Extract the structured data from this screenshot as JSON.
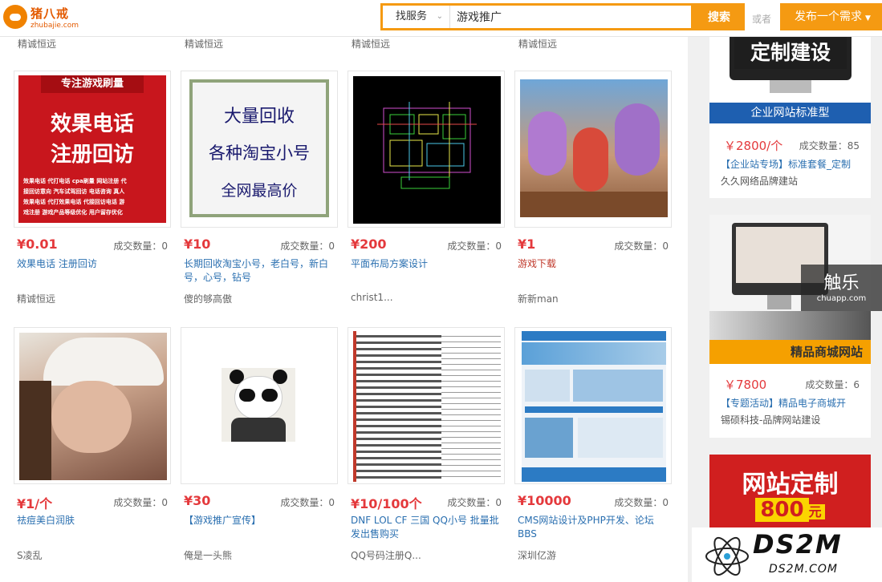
{
  "header": {
    "logo_cn": "猪八戒",
    "logo_en": "zhubajie.com",
    "search_type": "找服务",
    "search_value": "游戏推广",
    "search_button": "搜索",
    "or_text": "或者",
    "publish_button": "发布一个需求"
  },
  "prev_row_sellers": [
    "精诚恒远",
    "精诚恒远",
    "精诚恒远",
    "精诚恒远"
  ],
  "cards": [
    {
      "price": "¥0.01",
      "deals": "成交数量：0",
      "title": "效果电话 注册回访",
      "seller": "精诚恒远",
      "img_header": "专注游戏刷量",
      "img_line1": "效果电话",
      "img_line2": "注册回访",
      "img_small": [
        "效果电话 代打电话 cpa刷量 网站注册 代",
        "接回访意向 汽车试驾回访 电话咨询 真人",
        "效果电话 代打效果电话 代接回访电话 游",
        "戏注册 游戏产品等级优化 用户留存优化"
      ]
    },
    {
      "price": "¥10",
      "deals": "成交数量：0",
      "title": "长期回收淘宝小号，老白号，新白号，心号，钻号",
      "seller": "傻的够高傲",
      "img_lines": [
        "大量回收",
        "各种淘宝小号",
        "全网最高价"
      ]
    },
    {
      "price": "¥200",
      "deals": "成交数量：0",
      "title": "平面布局方案设计",
      "seller": "christ1..."
    },
    {
      "price": "¥1",
      "deals": "成交数量：0",
      "title": "游戏下载",
      "seller": "新新man"
    },
    {
      "price": "¥1/个",
      "deals": "成交数量：0",
      "title": "祛痘美白润肤",
      "seller": "S凌乱"
    },
    {
      "price": "¥30",
      "deals": "成交数量：0",
      "title": "【游戏推广宣传】",
      "seller": "俺是一头熊"
    },
    {
      "price": "¥10/100个",
      "deals": "成交数量：0",
      "title": "DNF LOL CF 三国 QQ小号 批量批发出售购买",
      "seller": "QQ号码注册Q..."
    },
    {
      "price": "¥10000",
      "deals": "成交数量：0",
      "title": "CMS网站设计及PHP开发、论坛BBS",
      "seller": "深圳亿游"
    }
  ],
  "sidebar": {
    "ad1": {
      "img_text": "定制建设",
      "banner": "企业网站标准型",
      "price": "￥2800/个",
      "deals": "成交数量：85",
      "title": "【企业站专场】标准套餐_定制",
      "seller": "久久网络品牌建站"
    },
    "ad2": {
      "banner": "精品商城网站",
      "price": "￥7800",
      "deals": "成交数量：6",
      "title": "【专题活动】精品电子商城开",
      "seller": "锡硕科技-品牌网站建设"
    },
    "ad3": {
      "line1": "网站定制",
      "line2": "800",
      "unit": "元"
    }
  },
  "watermark": {
    "big": "触乐",
    "small": "chuapp.com"
  },
  "ds2m": {
    "big": "DS2M",
    "small": "DS2M.COM"
  },
  "colors": {
    "accent": "#f59a12",
    "price": "#e4393c",
    "link": "#2a6fb0"
  }
}
